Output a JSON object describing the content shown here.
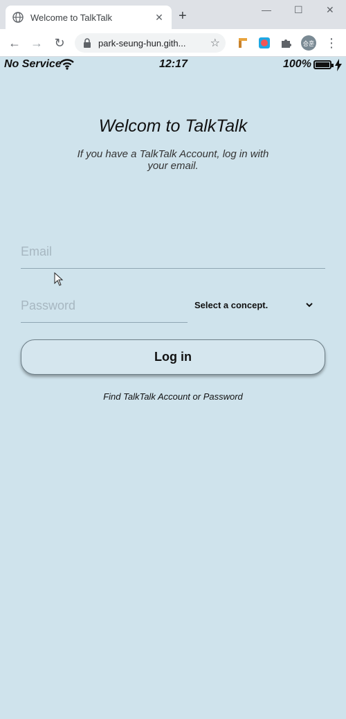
{
  "browser": {
    "tab_title": "Welcome to TalkTalk",
    "tab_close": "✕",
    "new_tab": "+",
    "url": "park-seung-hun.gith...",
    "star": "☆",
    "back": "←",
    "forward": "→",
    "reload": "↻",
    "menu": "⋮",
    "window_controls": {
      "minimize": "—",
      "maximize": "☐",
      "close": "✕"
    },
    "profile_initials": "승훈"
  },
  "status_bar": {
    "carrier": "No Service",
    "time": "12:17",
    "battery": "100%"
  },
  "welcome": {
    "title": "Welcom to TalkTalk",
    "subtitle": "If you have a TalkTalk Account, log in with your email."
  },
  "form": {
    "email_placeholder": "Email",
    "password_placeholder": "Password",
    "concept_label": "Select a concept.",
    "login_label": "Log in",
    "find_link": "Find TalkTalk Account or Password"
  },
  "colors": {
    "background": "#cfe3ec",
    "field_underline": "#8fa6b3",
    "placeholder": "#a7b7c1"
  }
}
